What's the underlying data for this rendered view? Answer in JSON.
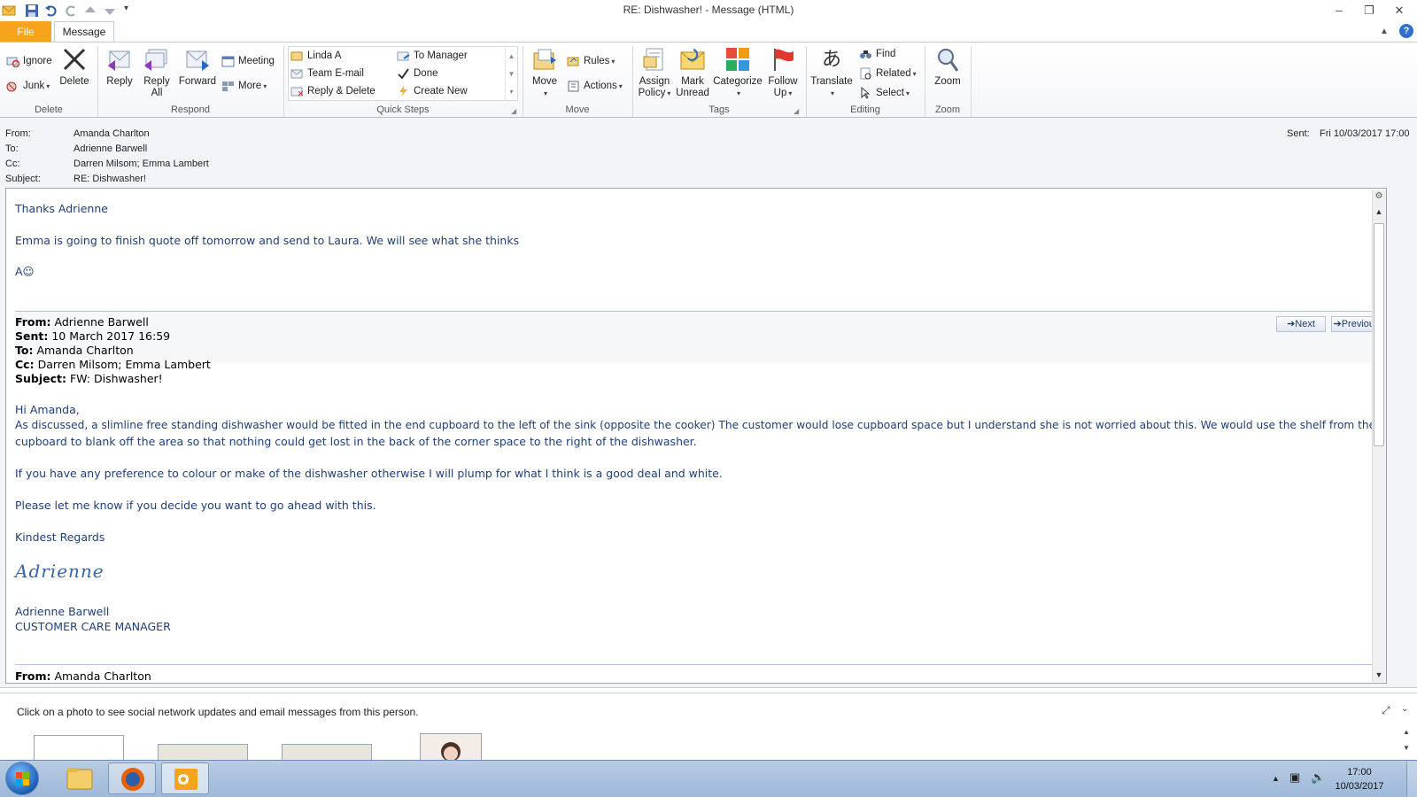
{
  "window": {
    "title": "RE: Dishwasher!  -  Message (HTML)",
    "controls": {
      "minimize": "–",
      "restore": "❐",
      "close": "✕"
    }
  },
  "tabs": {
    "file": "File",
    "message": "Message"
  },
  "ribbon": {
    "delete": {
      "ignore": "Ignore",
      "junk": "Junk",
      "delete": "Delete",
      "group": "Delete"
    },
    "respond": {
      "reply": "Reply",
      "reply_all_1": "Reply",
      "reply_all_2": "All",
      "forward": "Forward",
      "meeting": "Meeting",
      "more": "More",
      "group": "Respond"
    },
    "quick_steps": {
      "items": [
        "Linda A",
        "Team E-mail",
        "Reply & Delete",
        "To Manager",
        "Done",
        "Create New"
      ],
      "group": "Quick Steps"
    },
    "move": {
      "move": "Move",
      "rules": "Rules",
      "actions": "Actions",
      "group": "Move"
    },
    "tags": {
      "assign_1": "Assign",
      "assign_2": "Policy",
      "mark_1": "Mark",
      "mark_2": "Unread",
      "categorize": "Categorize",
      "follow_1": "Follow",
      "follow_2": "Up",
      "group": "Tags"
    },
    "editing": {
      "translate": "Translate",
      "find": "Find",
      "related": "Related",
      "select": "Select",
      "group": "Editing"
    },
    "zoom": {
      "zoom": "Zoom",
      "group": "Zoom"
    }
  },
  "header": {
    "from_label": "From:",
    "from": "Amanda Charlton",
    "to_label": "To:",
    "to": "Adrienne Barwell",
    "cc_label": "Cc:",
    "cc": "Darren Milsom; Emma Lambert",
    "subject_label": "Subject:",
    "subject": "RE: Dishwasher!",
    "sent_label": "Sent:",
    "sent": "Fri 10/03/2017 17:00"
  },
  "body": {
    "greeting": "Thanks Adrienne",
    "line1": "Emma is going to finish quote off tomorrow and send to Laura.  We will see what she thinks",
    "sign": "A☺",
    "fwd": {
      "from_label": "From:",
      "from": "Adrienne Barwell",
      "sent_label": "Sent:",
      "sent": "10 March 2017 16:59",
      "to_label": "To:",
      "to": "Amanda Charlton",
      "cc_label": "Cc:",
      "cc": "Darren Milsom; Emma Lambert",
      "subject_label": "Subject:",
      "subject": "FW: Dishwasher!"
    },
    "next": "Next",
    "previous": "Previous",
    "hi": "Hi Amanda,",
    "p1a": "As discussed, a slimline free standing dishwasher would be fitted in the end cupboard to the left of the sink (opposite the cooker)  The customer would lose cupboard space but I understand she is not worried about this.  We would use the shelf from the",
    "p1b": "cupboard to blank off the area so that nothing could get lost in the back of the corner space to the right of the dishwasher.",
    "p2": "If you have any preference to colour or make of the dishwasher otherwise I will plump for what I think is a good deal and white.",
    "p3": "Please let me know if you decide you want to go ahead with this.",
    "regards": "Kindest Regards",
    "signature": "Adrienne",
    "sig_name": "Adrienne Barwell",
    "sig_title": "CUSTOMER CARE MANAGER",
    "next_from_label": "From:",
    "next_from": "Amanda Charlton"
  },
  "people_pane": {
    "hint": "Click on a photo to see social network updates and email messages from this person."
  },
  "taskbar": {
    "time": "17:00",
    "date": "10/03/2017"
  }
}
